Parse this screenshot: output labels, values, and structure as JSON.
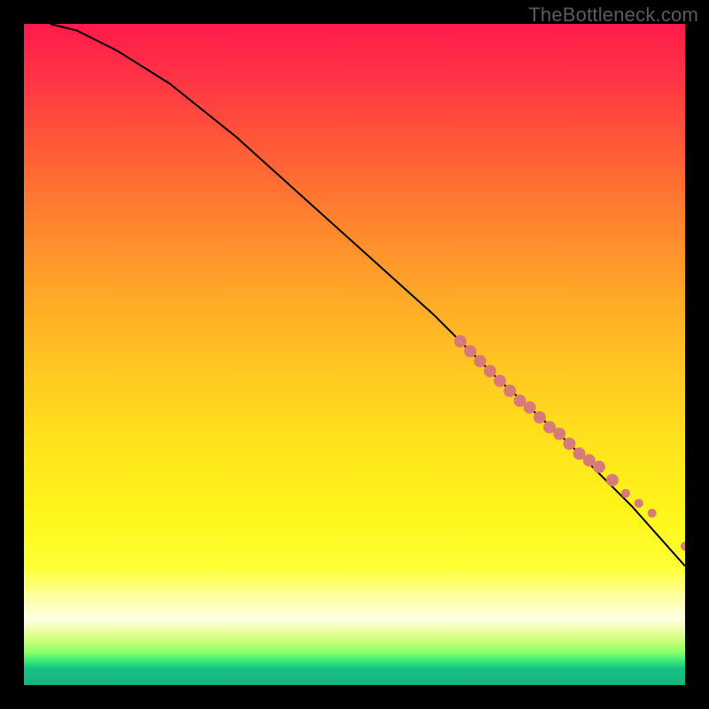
{
  "watermark": "TheBottleneck.com",
  "colors": {
    "frame": "#000000",
    "curve": "#000000",
    "dot": "#d97a7a"
  },
  "chart_data": {
    "type": "line",
    "title": "",
    "xlabel": "",
    "ylabel": "",
    "xlim": [
      0,
      100
    ],
    "ylim": [
      0,
      100
    ],
    "note": "No axis ticks or numeric labels are rendered in the source image; x/y values below are estimated normalized positions (0–100 each axis, y increasing upward) read from the plotted curve and marker pixels.",
    "series": [
      {
        "name": "curve",
        "x": [
          4,
          8,
          14,
          22,
          32,
          42,
          52,
          62,
          72,
          82,
          92,
          100
        ],
        "y": [
          100,
          99,
          96,
          91,
          83,
          74,
          65,
          56,
          46,
          37,
          27,
          18
        ]
      },
      {
        "name": "markers",
        "type": "scatter",
        "x": [
          66,
          67.5,
          69,
          70.5,
          72,
          73.5,
          75,
          76.5,
          78,
          79.5,
          81,
          82.5,
          84,
          85.5,
          87,
          89,
          91,
          93,
          95,
          100
        ],
        "y": [
          52,
          50.5,
          49,
          47.5,
          46,
          44.5,
          43,
          42,
          40.5,
          39,
          38,
          36.5,
          35,
          34,
          33,
          31,
          29,
          27.5,
          26,
          21
        ]
      }
    ]
  }
}
